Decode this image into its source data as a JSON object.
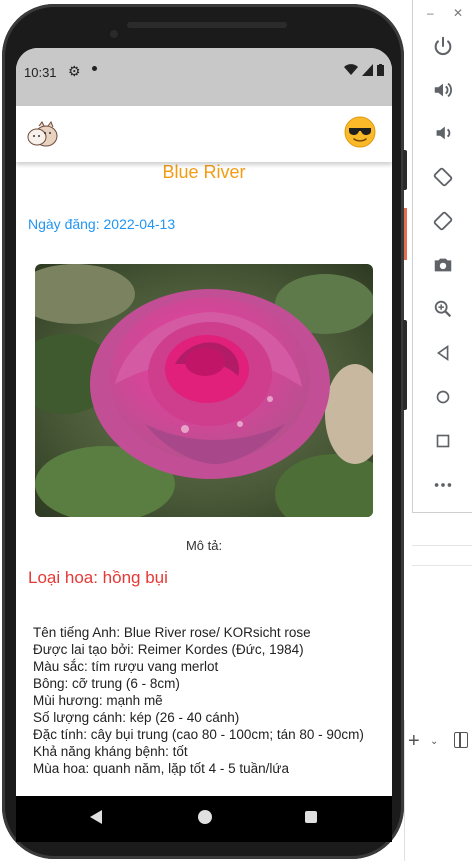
{
  "status_bar": {
    "time": "10:31"
  },
  "app": {
    "title": "Blue River",
    "post_date": "Ngày đăng: 2022-04-13",
    "description_label": "Mô tả:",
    "flower_type": "Loại hoa: hồng bụi",
    "details": [
      "Tên tiếng Anh: Blue River rose/ KORsicht rose",
      "Được lai tạo bởi: Reimer Kordes (Đức, 1984)",
      "Màu sắc: tím rượu vang merlot",
      "Bông: cỡ trung (6 - 8cm)",
      "Mùi hương: mạnh mẽ",
      "Số lượng cánh: kép (26 - 40 cánh)",
      "Đặc tính: cây bụi trung (cao 80 - 100cm; tán 80 - 90cm)",
      "Khả năng kháng bệnh: tốt",
      "Mùa hoa: quanh năm, lặp tốt 4 - 5 tuần/lứa"
    ]
  },
  "colors": {
    "title": "#f39c12",
    "date": "#2196f3",
    "flower_type": "#e53935",
    "status_bar": "#c8c8c8"
  },
  "icons": {
    "app_logo": "mascot-cat-icon",
    "profile": "sunglasses-emoji-icon",
    "emulator_toolbar": [
      "power-icon",
      "volume-up-icon",
      "volume-down-icon",
      "rotate-left-icon",
      "rotate-right-icon",
      "camera-icon",
      "zoom-icon",
      "back-icon",
      "home-icon",
      "overview-icon",
      "more-icon"
    ]
  }
}
